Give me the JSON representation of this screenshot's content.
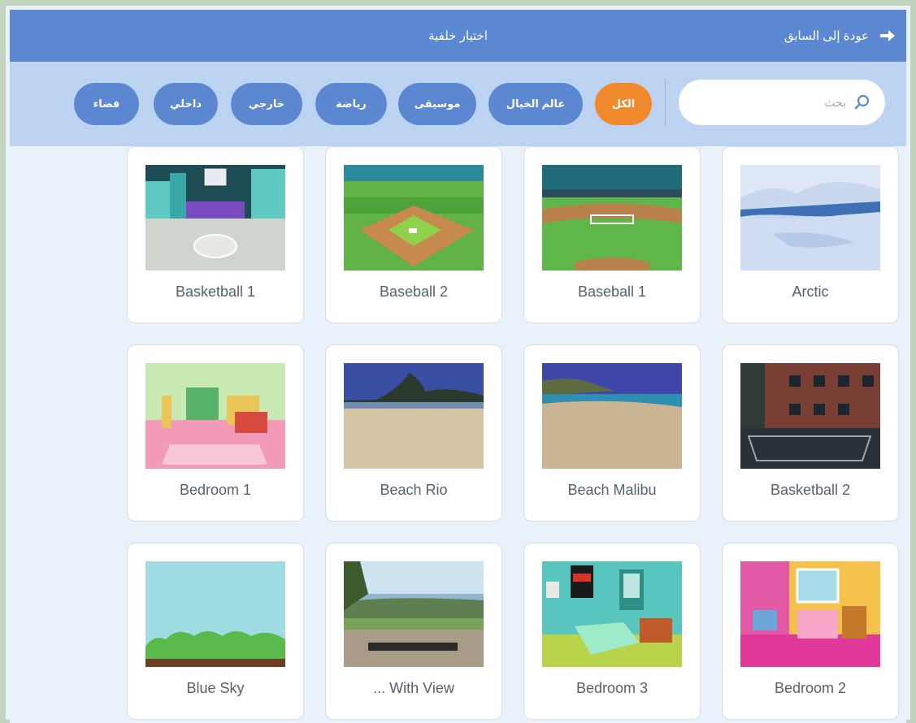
{
  "header": {
    "back_label": "عودة إلى السابق",
    "title": "اختيار خلفية"
  },
  "search": {
    "placeholder": "بحث"
  },
  "categories": [
    {
      "label": "الكل",
      "active": true
    },
    {
      "label": "عالم الخيال",
      "active": false
    },
    {
      "label": "موسيقى",
      "active": false
    },
    {
      "label": "رياضة",
      "active": false
    },
    {
      "label": "خارجي",
      "active": false
    },
    {
      "label": "داخلي",
      "active": false
    },
    {
      "label": "فضاء",
      "active": false
    }
  ],
  "backdrops": [
    {
      "name": "Arctic"
    },
    {
      "name": "Baseball 1"
    },
    {
      "name": "Baseball 2"
    },
    {
      "name": "Basketball 1"
    },
    {
      "name": "Basketball 2"
    },
    {
      "name": "Beach Malibu"
    },
    {
      "name": "Beach Rio"
    },
    {
      "name": "Bedroom 1"
    },
    {
      "name": "Bedroom 2"
    },
    {
      "name": "Bedroom 3"
    },
    {
      "name": "... With View"
    },
    {
      "name": "Blue Sky"
    }
  ],
  "colors": {
    "header": "#5b88d1",
    "filter_bar": "#bdd3f2",
    "active_category": "#f08a2c",
    "category": "#5b88d1",
    "background": "#e9f1fb"
  }
}
